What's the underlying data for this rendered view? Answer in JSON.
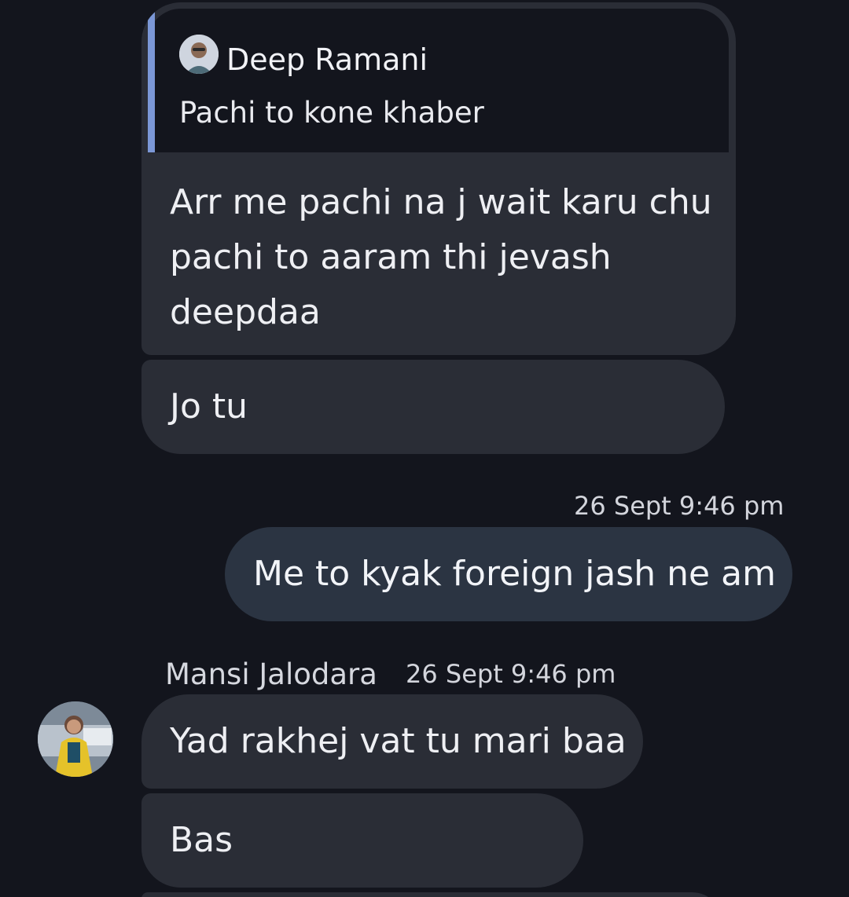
{
  "reply_message": {
    "quoted": {
      "author": "Deep Ramani",
      "text": "Pachi to kone khaber",
      "avatar_icon": "user-avatar-icon"
    },
    "text": "Arr me pachi na j wait karu chu pachi to aaram thi jevash deepdaa"
  },
  "messages_in_1": [
    {
      "text": "Jo tu"
    }
  ],
  "outgoing": {
    "timestamp": "26 Sept 9:46 pm",
    "text": "Me to kyak foreign jash ne am"
  },
  "incoming_group": {
    "sender": "Mansi Jalodara",
    "timestamp": "26 Sept 9:46 pm",
    "avatar_icon": "user-avatar-icon",
    "messages": [
      {
        "text": "Yad rakhej vat tu mari baa"
      },
      {
        "text": "Bas"
      }
    ]
  },
  "colors": {
    "background": "#13151d",
    "incoming_bubble": "#2a2d36",
    "outgoing_bubble": "#2b3442",
    "quote_bar": "#7b97d6"
  }
}
